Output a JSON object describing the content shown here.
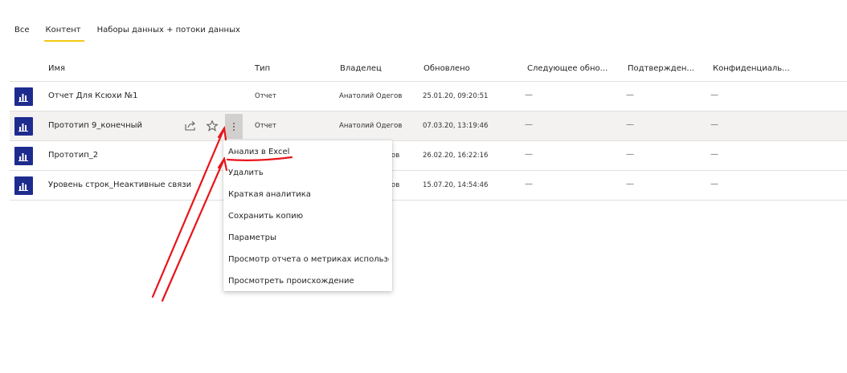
{
  "tabs": [
    {
      "label": "Все",
      "active": false
    },
    {
      "label": "Контент",
      "active": true
    },
    {
      "label": "Наборы данных + потоки данных",
      "active": false
    }
  ],
  "columns": {
    "name": "Имя",
    "type": "Тип",
    "owner": "Владелец",
    "updated": "Обновлено",
    "next": "Следующее обно...",
    "endorsed": "Подтвержден...",
    "sensitivity": "Конфиденциаль..."
  },
  "rows": [
    {
      "name": "Отчет Для Ксюхи №1",
      "type": "Отчет",
      "owner": "Анатолий Одегов",
      "updated": "25.01.20, 09:20:51",
      "next": "—",
      "endorsed": "—",
      "sensitivity": "—"
    },
    {
      "name": "Прототип 9_конечный",
      "type": "Отчет",
      "owner": "Анатолий Одегов",
      "updated": "07.03.20, 13:19:46",
      "next": "—",
      "endorsed": "—",
      "sensitivity": "—"
    },
    {
      "name": "Прототип_2",
      "type": "",
      "owner": "ов",
      "updated": "26.02.20, 16:22:16",
      "next": "—",
      "endorsed": "—",
      "sensitivity": "—"
    },
    {
      "name": "Уровень строк_Неактивные связи",
      "type": "",
      "owner": "ов",
      "updated": "15.07.20, 14:54:46",
      "next": "—",
      "endorsed": "—",
      "sensitivity": "—"
    }
  ],
  "context_menu": {
    "items": [
      "Анализ в Excel",
      "Удалить",
      "Краткая аналитика",
      "Сохранить копию",
      "Параметры",
      "Просмотр отчета о метриках использо...",
      "Просмотреть происхождение"
    ]
  },
  "icons": {
    "report": "bar-chart-icon",
    "share": "share-icon",
    "favorite": "star-icon",
    "more": "more-vertical-icon"
  },
  "colors": {
    "accent": "#f2c811",
    "report_icon_bg": "#1e2b8e",
    "annotation": "#e8141b",
    "hover_row": "#f3f2f1"
  }
}
